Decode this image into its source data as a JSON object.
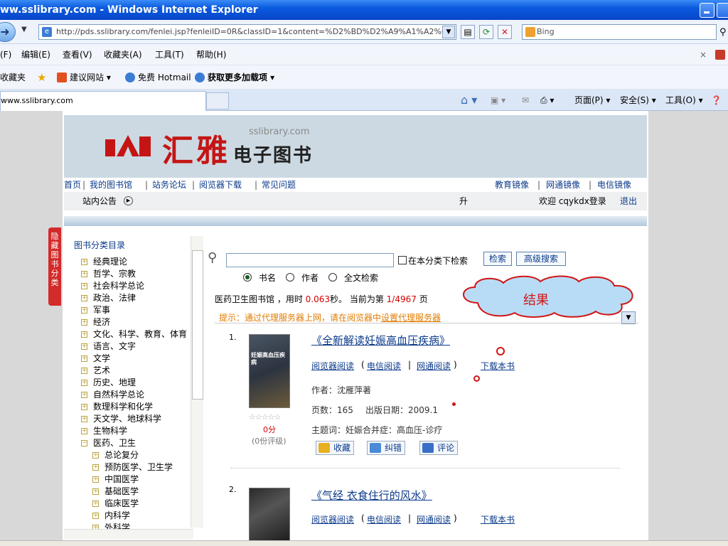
{
  "window": {
    "title": "ww.sslibrary.com - Windows Internet Explorer"
  },
  "addressbar": {
    "url": "http://pds.sslibrary.com/fenlei.jsp?fenleiID=0R&classID=1&content=%D2%BD%D2%A9%A1%A2%CE",
    "search_placeholder": "Bing"
  },
  "menubar": {
    "items": [
      "(F)",
      "编辑(E)",
      "查看(V)",
      "收藏夹(A)",
      "工具(T)",
      "帮助(H)"
    ]
  },
  "favbar": {
    "items": [
      "收藏夹",
      "建议网站 ▾",
      "免费 Hotmail",
      "获取更多加载项 ▾"
    ]
  },
  "tabbar": {
    "tab_label": "www.sslibrary.com",
    "commands": [
      "页面(P) ▾",
      "安全(S) ▾",
      "工具(O) ▾"
    ]
  },
  "site": {
    "logo_text": "汇雅",
    "logo_domain": "sslibrary.com",
    "logo_sub": "电子图书",
    "nav_left": [
      "首页",
      "我的图书馆",
      "站务论坛",
      "阅览器下载",
      "常见问题"
    ],
    "nav_right": [
      "教育镜像",
      "网通镜像",
      "电信镜像"
    ],
    "notice_label": "站内公告",
    "notice_arrow": "▶",
    "notice_mid": "升",
    "welcome": "欢迎 cqykdx登录",
    "logout": "退出",
    "hide_tab": "隐藏图书分类"
  },
  "sidebar": {
    "heading": "图书分类目录",
    "categories": [
      {
        "pm": "+",
        "label": "经典理论"
      },
      {
        "pm": "+",
        "label": "哲学、宗教"
      },
      {
        "pm": "+",
        "label": "社会科学总论"
      },
      {
        "pm": "+",
        "label": "政治、法律"
      },
      {
        "pm": "+",
        "label": "军事"
      },
      {
        "pm": "+",
        "label": "经济"
      },
      {
        "pm": "+",
        "label": "文化、科学、教育、体育"
      },
      {
        "pm": "+",
        "label": "语言、文字"
      },
      {
        "pm": "+",
        "label": "文学"
      },
      {
        "pm": "+",
        "label": "艺术"
      },
      {
        "pm": "+",
        "label": "历史、地理"
      },
      {
        "pm": "+",
        "label": "自然科学总论"
      },
      {
        "pm": "+",
        "label": "数理科学和化学"
      },
      {
        "pm": "+",
        "label": "天文学、地球科学"
      },
      {
        "pm": "+",
        "label": "生物科学"
      },
      {
        "pm": "−",
        "label": "医药、卫生"
      }
    ],
    "subcategories": [
      {
        "pm": "+",
        "label": "总论复分"
      },
      {
        "pm": "+",
        "label": "预防医学、卫生学"
      },
      {
        "pm": "+",
        "label": "中国医学"
      },
      {
        "pm": "+",
        "label": "基础医学"
      },
      {
        "pm": "+",
        "label": "临床医学"
      },
      {
        "pm": "+",
        "label": "内科学"
      },
      {
        "pm": "+",
        "label": "外科学"
      }
    ]
  },
  "search": {
    "in_category_label": "在本分类下检索",
    "search_button": "检索",
    "advanced_button": "高级搜索",
    "radio_title": "书名",
    "radio_author": "作者",
    "radio_fulltext": "全文检索"
  },
  "results": {
    "library": "医药卫生图书馆 ，用时",
    "time": "0.063",
    "time_unit": "秒。 当前为第",
    "page": "1/4967",
    "page_unit": "页",
    "tip_prefix": "提示：通过代理服务器上网，请在阅览器中",
    "tip_link": "设置代理服务器",
    "cloud_text": "结果"
  },
  "books": [
    {
      "index": "1.",
      "title": "《全新解读妊娠高血压疾病》",
      "read_reader": "阅览器阅读",
      "read_dianxin": "电信阅读",
      "read_wangtong": "网通阅读",
      "download": "下载本书",
      "author": "作者：沈雁萍著",
      "pages": "页数：165",
      "date": "出版日期：2009.1",
      "subject": "主题词：妊娠合并症：高血压-诊疗",
      "score": "0分",
      "ratings": "(0份评级)",
      "stars": "☆☆☆☆☆",
      "btn_fav": "收藏",
      "btn_err": "纠错",
      "btn_comment": "评论",
      "cover_text": "妊娠高血压疾病"
    },
    {
      "index": "2.",
      "title": "《气经 衣食住行的风水》",
      "read_reader": "阅览器阅读",
      "read_dianxin": "电信阅读",
      "read_wangtong": "网通阅读",
      "download": "下载本书"
    }
  ],
  "colors": {
    "link": "#0b3a8a",
    "logo_red": "#c51414",
    "tip_orange": "#e07b00",
    "time_red": "#d40000"
  }
}
